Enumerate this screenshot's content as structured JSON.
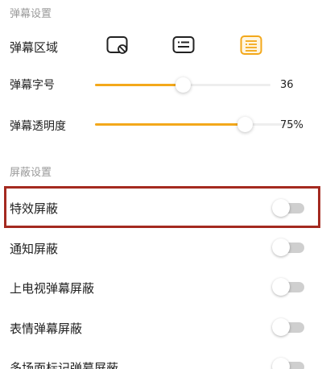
{
  "danmaku_settings": {
    "title": "弹幕设置",
    "area_label": "弹幕区域",
    "area_options": [
      {
        "icon": "screen-off-icon",
        "selected": false
      },
      {
        "icon": "list-icon",
        "selected": false
      },
      {
        "icon": "list-icon",
        "selected": true
      }
    ],
    "font_size": {
      "label": "弹幕字号",
      "value_text": "36",
      "fraction": 0.5
    },
    "opacity": {
      "label": "弹幕透明度",
      "value_text": "75%",
      "fraction": 0.75
    },
    "accent_color": "#f3a81b"
  },
  "block_settings": {
    "title": "屏蔽设置",
    "items": [
      {
        "label": "特效屏蔽",
        "enabled": false,
        "highlighted": true
      },
      {
        "label": "通知屏蔽",
        "enabled": false
      },
      {
        "label": "上电视弹幕屏蔽",
        "enabled": false
      },
      {
        "label": "表情弹幕屏蔽",
        "enabled": false
      },
      {
        "label": "多场面标记弹幕屏蔽",
        "enabled": false
      }
    ]
  },
  "highlight_color": "#a42a20"
}
